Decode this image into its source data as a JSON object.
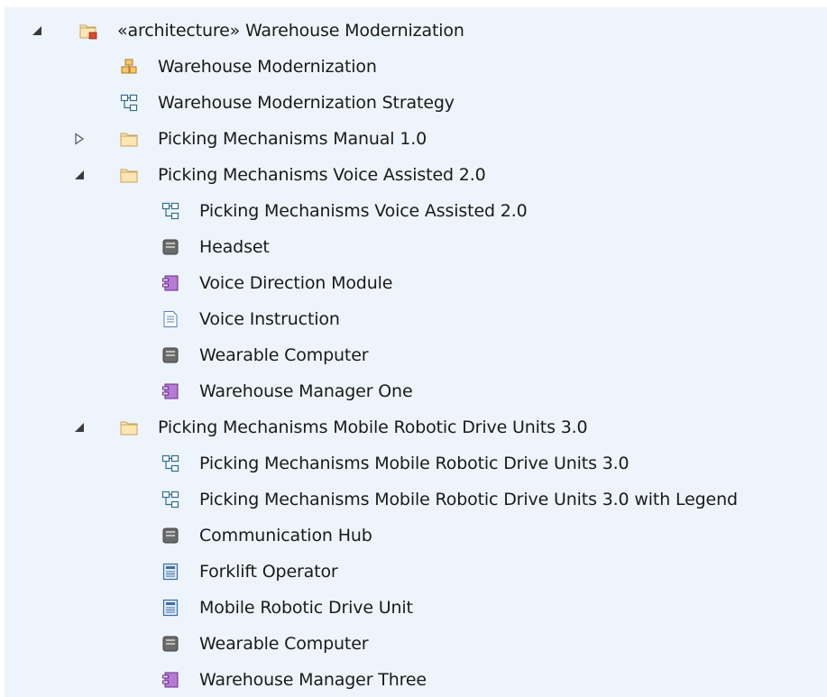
{
  "tree": {
    "nodes": [
      {
        "label": "«architecture» Warehouse Modernization",
        "icon": "architecture-package-icon",
        "level": 0,
        "toggle": "expanded"
      },
      {
        "label": "Warehouse Modernization",
        "icon": "component-element-icon",
        "level": 1
      },
      {
        "label": "Warehouse Modernization Strategy",
        "icon": "diagram-icon",
        "level": 1
      },
      {
        "label": "Picking Mechanisms Manual 1.0",
        "icon": "package-folder-icon",
        "level": 1,
        "toggle": "collapsed"
      },
      {
        "label": "Picking Mechanisms Voice Assisted 2.0",
        "icon": "package-folder-icon",
        "level": 1,
        "toggle": "expanded"
      },
      {
        "label": "Picking Mechanisms Voice Assisted 2.0",
        "icon": "diagram-icon",
        "level": 2
      },
      {
        "label": "Headset",
        "icon": "device-node-icon",
        "level": 2
      },
      {
        "label": "Voice Direction Module",
        "icon": "component-icon",
        "level": 2
      },
      {
        "label": "Voice Instruction",
        "icon": "document-icon",
        "level": 2
      },
      {
        "label": "Wearable Computer",
        "icon": "device-node-icon",
        "level": 2
      },
      {
        "label": "Warehouse Manager One",
        "icon": "component-icon",
        "level": 2
      },
      {
        "label": "Picking Mechanisms Mobile Robotic Drive Units 3.0",
        "icon": "package-folder-icon",
        "level": 1,
        "toggle": "expanded"
      },
      {
        "label": "Picking Mechanisms Mobile Robotic Drive Units 3.0",
        "icon": "diagram-icon",
        "level": 2
      },
      {
        "label": "Picking Mechanisms Mobile Robotic Drive Units 3.0 with Legend",
        "icon": "diagram-icon",
        "level": 2
      },
      {
        "label": "Communication Hub",
        "icon": "device-node-icon",
        "level": 2
      },
      {
        "label": "Forklift Operator",
        "icon": "execution-environment-icon",
        "level": 2
      },
      {
        "label": "Mobile Robotic Drive Unit",
        "icon": "execution-environment-icon",
        "level": 2
      },
      {
        "label": "Wearable Computer",
        "icon": "device-node-icon",
        "level": 2
      },
      {
        "label": "Warehouse Manager Three",
        "icon": "component-icon",
        "level": 2
      }
    ]
  },
  "colors": {
    "panel_background": "#eef4fb",
    "folder_fill": "#fde6b4",
    "folder_stroke": "#c8a45a",
    "component_purple": "#8e3fb0",
    "component_orange": "#e8a33a",
    "device_gray": "#6b6b6b",
    "diagram_teal": "#2f6f8f",
    "architecture_red": "#d94a2b"
  }
}
